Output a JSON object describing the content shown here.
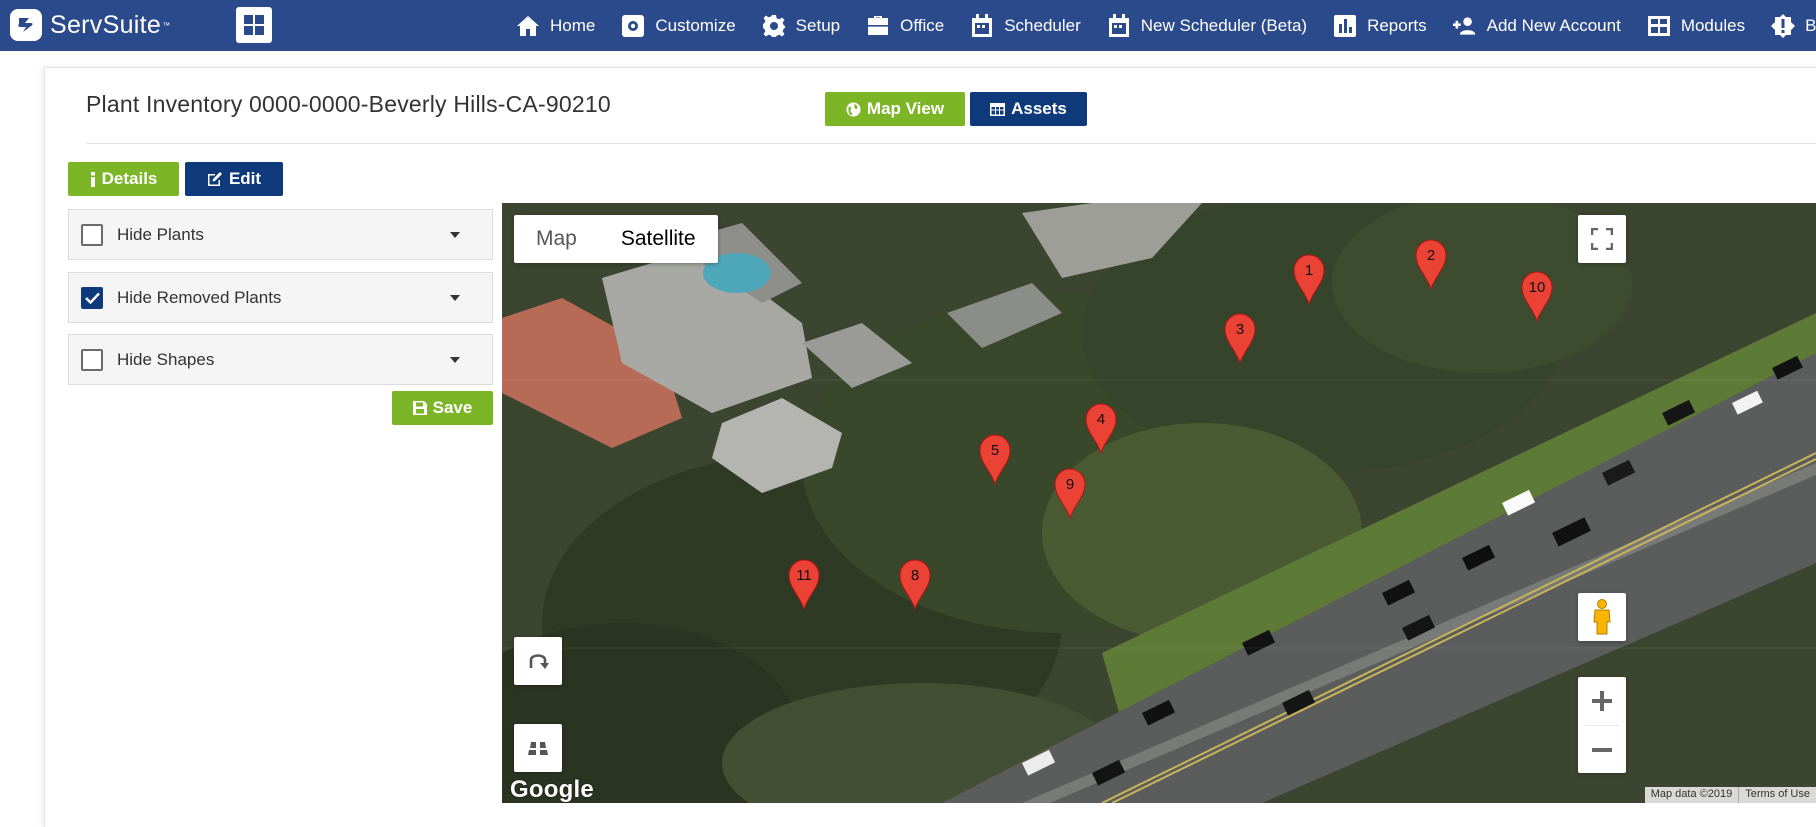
{
  "brand": {
    "name": "ServSuite",
    "tm": "™"
  },
  "nav": [
    {
      "label": "Home",
      "icon": "home-icon"
    },
    {
      "label": "Customize",
      "icon": "gear-square-icon"
    },
    {
      "label": "Setup",
      "icon": "gear-icon"
    },
    {
      "label": "Office",
      "icon": "briefcase-icon"
    },
    {
      "label": "Scheduler",
      "icon": "calendar-icon"
    },
    {
      "label": "New Scheduler (Beta)",
      "icon": "calendar-icon"
    },
    {
      "label": "Reports",
      "icon": "bar-chart-icon"
    },
    {
      "label": "Add New Account",
      "icon": "add-user-icon"
    },
    {
      "label": "Modules",
      "icon": "modules-icon"
    },
    {
      "label": "Be",
      "icon": "alert-badge-icon"
    }
  ],
  "page": {
    "title": "Plant Inventory 0000-0000-Beverly Hills-CA-90210",
    "map_view_label": "Map View",
    "assets_label": "Assets",
    "details_label": "Details",
    "edit_label": "Edit",
    "save_label": "Save"
  },
  "filters": [
    {
      "label": "Hide Plants",
      "checked": false
    },
    {
      "label": "Hide Removed Plants",
      "checked": true
    },
    {
      "label": "Hide Shapes",
      "checked": false
    }
  ],
  "map": {
    "type_map": "Map",
    "type_satellite": "Satellite",
    "selected_type": "Satellite",
    "google_label": "Google",
    "map_data": "Map data ©2019",
    "terms": "Terms of Use",
    "markers": [
      "1",
      "2",
      "10",
      "3",
      "4",
      "5",
      "9",
      "11",
      "8"
    ]
  },
  "colors": {
    "navbar": "#2b4a8b",
    "green": "#7cb526",
    "navy": "#0e3a7c",
    "marker": "#ea4335"
  }
}
